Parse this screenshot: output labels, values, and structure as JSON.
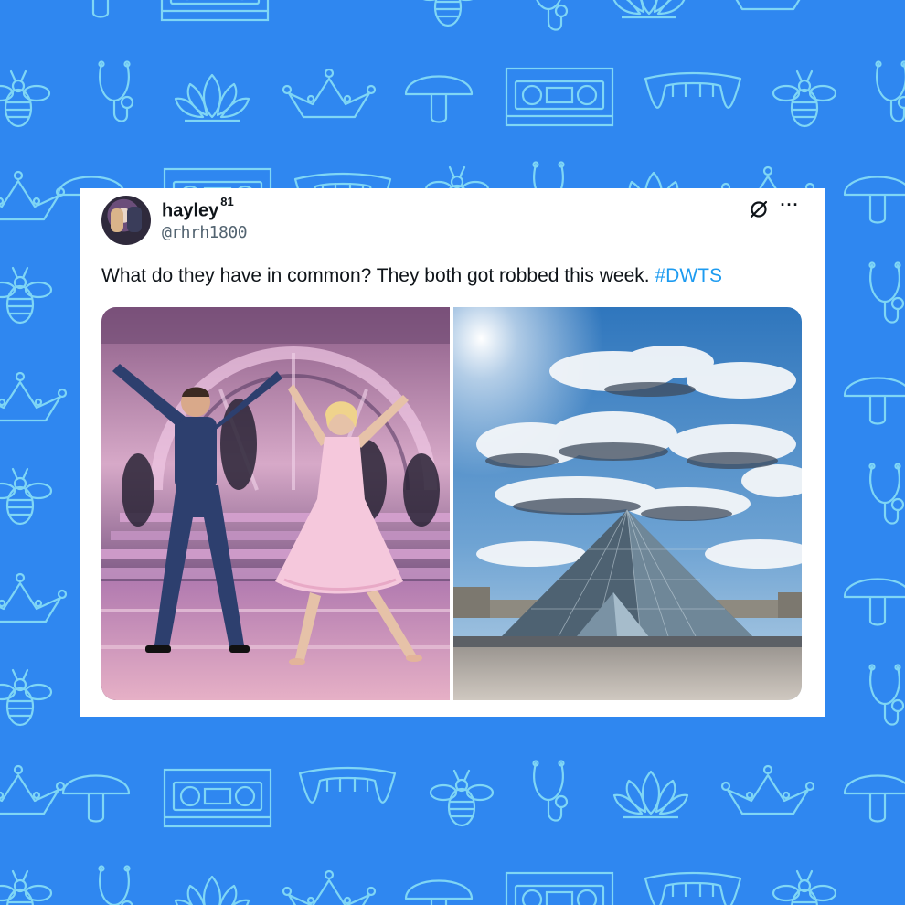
{
  "post": {
    "display_name": "hayley",
    "badge": "81",
    "handle": "@rhrh1800",
    "text_main": "What do they have in common? They both got robbed this week.",
    "hashtag": "#DWTS",
    "more_label": "···"
  },
  "icons": {
    "grok": "grok-slash-icon",
    "more": "more-options-icon",
    "background": [
      "bee-icon",
      "stethoscope-icon",
      "lotus-icon",
      "crown-icon",
      "mushroom-icon",
      "vhs-tape-icon",
      "fangs-icon"
    ]
  },
  "colors": {
    "background": "#2f87f0",
    "pattern_line": "#7fd6f5",
    "card": "#ffffff",
    "text": "#0f1419",
    "secondary_text": "#536471",
    "link": "#1d9bf0"
  }
}
